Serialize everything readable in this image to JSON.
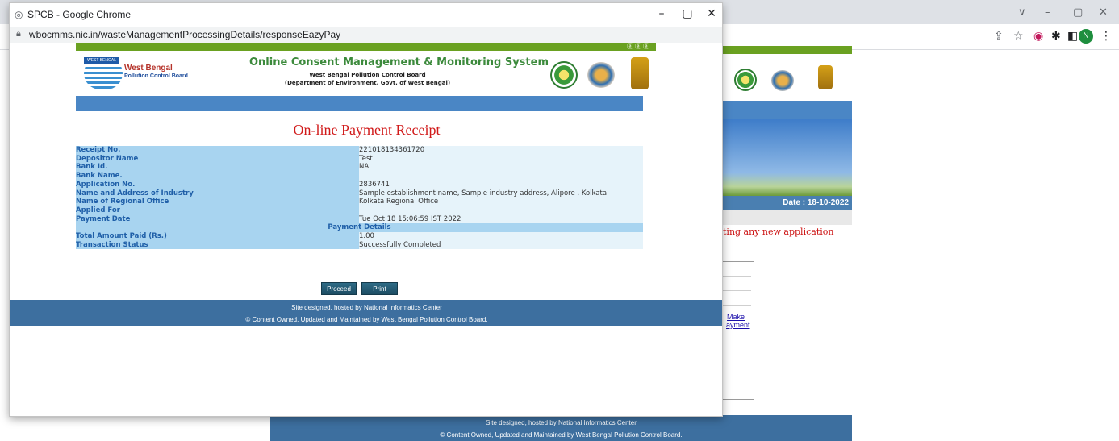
{
  "background_window": {
    "window_controls": {
      "chevron": "∨",
      "minimize": "–",
      "restore": "▢",
      "close": "✕"
    },
    "toolbar_icons": [
      "share-icon",
      "star-icon",
      "extension-icon",
      "puzzle-icon",
      "sidebar-icon"
    ],
    "profile_initial": "N",
    "date_label": "Date : 18-10-2022",
    "notice_text": "ting any new application",
    "make_payment_link": [
      "Make",
      "ayment"
    ],
    "footer_line1": "Site designed, hosted by National Informatics Center",
    "footer_line2": "© Content Owned, Updated and Maintained by West Bengal Pollution Control Board."
  },
  "popup": {
    "window_title": "SPCB - Google Chrome",
    "window_controls": {
      "minimize": "–",
      "restore": "▢",
      "close": "✕"
    },
    "url": "wbocmms.nic.in/wasteManagementProcessingDetails/responseEazyPay",
    "header": {
      "logo_tag": "WEST BENGAL",
      "logo_title": "West Bengal",
      "logo_subtitle": "Pollution Control Board",
      "system_title": "Online Consent Management & Monitoring System",
      "system_subtitle1": "West Bengal Pollution Control Board",
      "system_subtitle2": "(Department of Environment, Govt. of West Bengal)"
    },
    "receipt_title": "On-line Payment Receipt",
    "rows": [
      {
        "label": "Receipt No.",
        "value": "221018134361720"
      },
      {
        "label": "Depositor Name",
        "value": "Test"
      },
      {
        "label": "Bank Id.",
        "value": "NA"
      },
      {
        "label": "Bank Name.",
        "value": ""
      },
      {
        "label": "Application No.",
        "value": "2836741"
      },
      {
        "label": "Name and Address of Industry",
        "value": "Sample establishment name, Sample industry address, Alipore , Kolkata"
      },
      {
        "label": "Name of Regional Office",
        "value": "Kolkata Regional Office"
      },
      {
        "label": "Applied For",
        "value": ""
      },
      {
        "label": "Payment Date",
        "value": "Tue Oct 18 15:06:59 IST 2022"
      }
    ],
    "section_heading": "Payment Details",
    "payment_rows": [
      {
        "label": "Total Amount Paid (Rs.)",
        "value": "1.00"
      },
      {
        "label": "Transaction Status",
        "value": "Successfully Completed"
      }
    ],
    "buttons": {
      "proceed": "Proceed",
      "print": "Print"
    },
    "footer_line1": "Site designed, hosted by National Informatics Center",
    "footer_line2": "© Content Owned, Updated and Maintained by West Bengal Pollution Control Board."
  }
}
